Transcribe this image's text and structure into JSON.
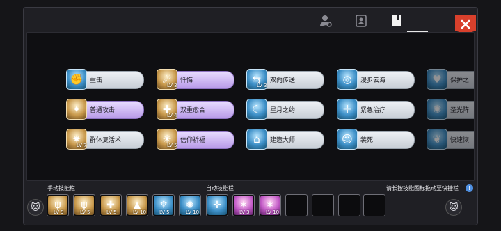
{
  "tabs": [
    {
      "icon": "person-settings-icon"
    },
    {
      "icon": "contact-card-icon"
    },
    {
      "icon": "skill-book-icon",
      "active": true
    }
  ],
  "close_icon": "close-icon",
  "skills": [
    {
      "name": "重击",
      "level": "",
      "style": "blue",
      "icon": "strike-icon"
    },
    {
      "name": "忏悔",
      "level": "LV 3",
      "style": "purple",
      "icon": "repent-icon"
    },
    {
      "name": "双向传送",
      "level": "LV 3",
      "style": "blue",
      "icon": "teleport-icon"
    },
    {
      "name": "漫步云海",
      "level": "",
      "style": "blue",
      "icon": "cloud-walk-icon"
    },
    {
      "name": "保护之",
      "level": "",
      "style": "blue",
      "icon": "shield-icon"
    },
    {
      "name": "普通攻击",
      "level": "",
      "style": "purple",
      "icon": "attack-icon"
    },
    {
      "name": "双重愈合",
      "level": "LV 4",
      "style": "purple",
      "icon": "double-heal-icon"
    },
    {
      "name": "星月之约",
      "level": "",
      "style": "blue",
      "icon": "star-moon-icon"
    },
    {
      "name": "紧急治疗",
      "level": "",
      "style": "blue",
      "icon": "emergency-heal-icon"
    },
    {
      "name": "圣光阵",
      "level": "",
      "style": "blue",
      "icon": "holy-circle-icon"
    },
    {
      "name": "群体复活术",
      "level": "LV 7",
      "style": "blue",
      "icon": "mass-revive-icon"
    },
    {
      "name": "信仰祈福",
      "level": "LV 5",
      "style": "purple",
      "icon": "faith-blessing-icon"
    },
    {
      "name": "建造大师",
      "level": "",
      "style": "blue",
      "icon": "build-master-icon"
    },
    {
      "name": "装死",
      "level": "",
      "style": "blue",
      "icon": "play-dead-icon"
    },
    {
      "name": "快速恢",
      "level": "",
      "style": "blue",
      "icon": "quick-recover-icon"
    }
  ],
  "manual_bar": {
    "label": "手动技能栏",
    "slots": [
      {
        "level": "LV 9",
        "color": "gold"
      },
      {
        "level": "LV 5",
        "color": "gold"
      },
      {
        "level": "LV 5",
        "color": "gold"
      },
      {
        "level": "LV 10",
        "color": "gold"
      },
      {
        "level": "LV 5",
        "color": "blue"
      },
      {
        "level": "LV 10",
        "color": "blue"
      }
    ]
  },
  "auto_bar": {
    "label": "自动技能栏",
    "slots": [
      {
        "level": "",
        "color": "blue"
      },
      {
        "level": "LV 3",
        "color": "pink"
      },
      {
        "level": "LV 10",
        "color": "pink"
      },
      {
        "level": "",
        "color": "empty"
      },
      {
        "level": "",
        "color": "empty"
      },
      {
        "level": "",
        "color": "empty"
      },
      {
        "level": "",
        "color": "empty"
      }
    ]
  },
  "hint": "请长按技能图标拖动至快捷栏",
  "colors": {
    "close": "#d8402c",
    "pill_blue": "#dfe4ea",
    "pill_purple": "#c8b0f0",
    "info": "#4f8fe0"
  }
}
